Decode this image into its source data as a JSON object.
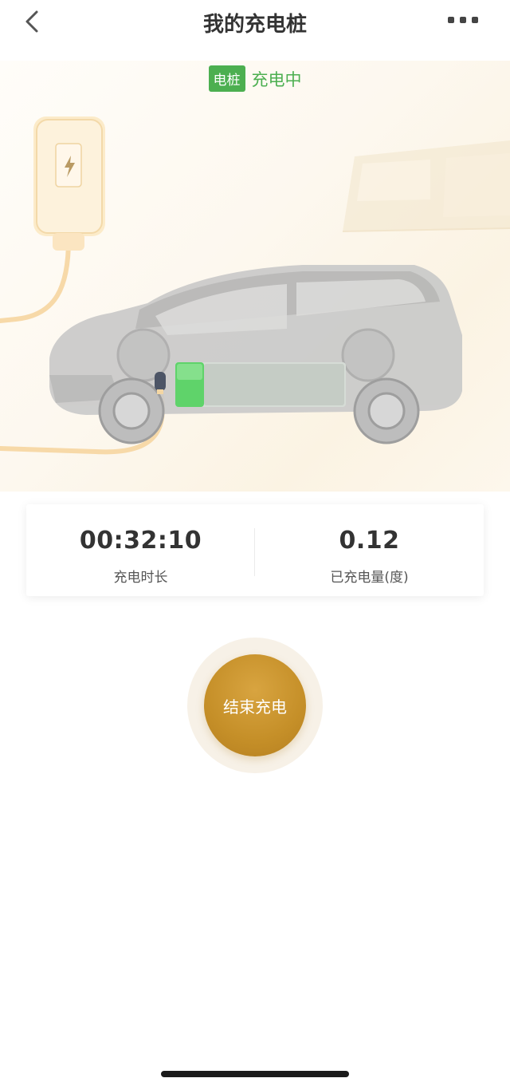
{
  "nav": {
    "title": "我的充电桩"
  },
  "status": {
    "badge": "电桩",
    "text": "充电中"
  },
  "stats": {
    "duration": {
      "value": "00:32:10",
      "label": "充电时长"
    },
    "energy": {
      "value": "0.12",
      "label": "已充电量(度)"
    }
  },
  "action": {
    "label": "结束充电"
  },
  "colors": {
    "accent_green": "#4caf50",
    "button_gold": "#c58f28"
  },
  "icons": [
    "back-arrow-icon",
    "more-icon",
    "charger-icon",
    "lightning-icon",
    "car-illustration"
  ]
}
